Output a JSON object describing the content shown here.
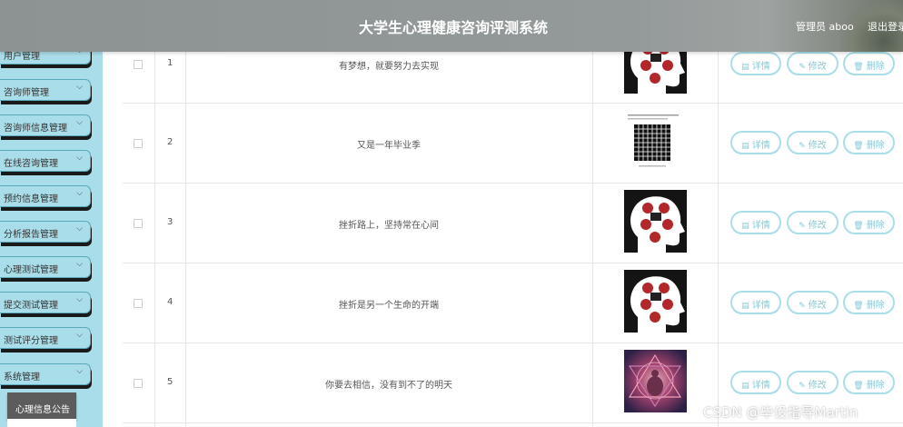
{
  "header": {
    "title": "大学生心理健康咨询评测系统",
    "admin_label": "管理员 aboo",
    "logout_label": "退出登录"
  },
  "sidebar": {
    "items": [
      {
        "label": "用户管理"
      },
      {
        "label": "咨询师管理"
      },
      {
        "label": "咨询师信息管理"
      },
      {
        "label": "在线咨询管理"
      },
      {
        "label": "预约信息管理"
      },
      {
        "label": "分析报告管理"
      },
      {
        "label": "心理测试管理"
      },
      {
        "label": "提交测试管理"
      },
      {
        "label": "测试评分管理"
      },
      {
        "label": "系统管理"
      }
    ],
    "notice_button": "心理信息公告"
  },
  "table": {
    "rows": [
      {
        "index": "1",
        "title": "有梦想，就要努力去实现",
        "image": "psych-test-head"
      },
      {
        "index": "2",
        "title": "又是一年毕业季",
        "image": "grid-chart"
      },
      {
        "index": "3",
        "title": "挫折路上，坚持常在心间",
        "image": "psych-test-head"
      },
      {
        "index": "4",
        "title": "挫折是另一个生命的开端",
        "image": "psych-test-head"
      },
      {
        "index": "5",
        "title": "你要去相信，没有到不了的明天",
        "image": "meditation-art"
      }
    ],
    "actions": {
      "detail": "详情",
      "edit": "修改",
      "delete": "删除"
    }
  },
  "watermark": "CSDN @毕设指导Martin",
  "colors": {
    "sidebar_bg": "#a9dde9",
    "header_bg": "#929898",
    "button_border": "#a9dde9",
    "button_text": "#86c8d8"
  }
}
